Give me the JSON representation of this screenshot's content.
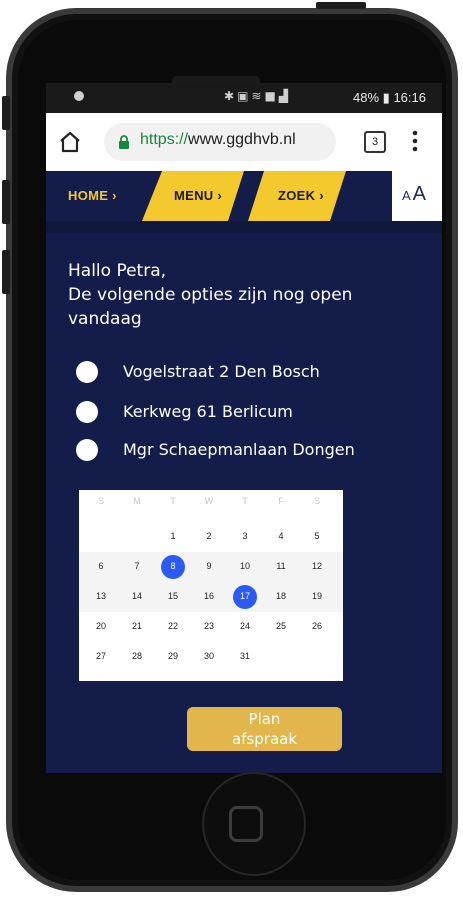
{
  "status_bar": {
    "battery": "48%",
    "time": "16:16",
    "icons": [
      "bluetooth-icon",
      "mute-icon",
      "wifi-icon",
      "nfc-icon",
      "signal-icon",
      "battery-icon"
    ]
  },
  "browser": {
    "url_scheme": "https://",
    "url_host": "www.ggdhvb.nl",
    "tab_count": "3"
  },
  "nav": {
    "home_label": "HOME ›",
    "menu_label": "MENU ›",
    "zoek_label": "ZOEK ›",
    "font_small": "A",
    "font_large": "A"
  },
  "greeting": {
    "line1": "Hallo Petra,",
    "line2": "De volgende opties zijn nog open vandaag"
  },
  "options": [
    {
      "label": "Vogelstraat 2 Den Bosch"
    },
    {
      "label": "Kerkweg 61 Berlicum"
    },
    {
      "label": "Mgr Schaepmanlaan Dongen"
    }
  ],
  "calendar": {
    "weekdays": [
      "S",
      "M",
      "T",
      "W",
      "T",
      "F",
      "S"
    ],
    "weeks": [
      [
        "",
        "",
        "1",
        "2",
        "3",
        "4",
        "5"
      ],
      [
        "6",
        "7",
        "8",
        "9",
        "10",
        "11",
        "12"
      ],
      [
        "13",
        "14",
        "15",
        "16",
        "17",
        "18",
        "19"
      ],
      [
        "20",
        "21",
        "22",
        "23",
        "24",
        "25",
        "26"
      ],
      [
        "27",
        "28",
        "29",
        "30",
        "31",
        "",
        ""
      ]
    ],
    "selected_days": [
      "8",
      "17"
    ],
    "selected_color": "#2b5bf0"
  },
  "plan_button": {
    "line1": "Plan",
    "line2": "afspraak"
  },
  "colors": {
    "background_navy": "#141d4a",
    "accent_yellow": "#f4c92d",
    "button_gold": "#e2b64a",
    "url_green": "#16883a"
  }
}
